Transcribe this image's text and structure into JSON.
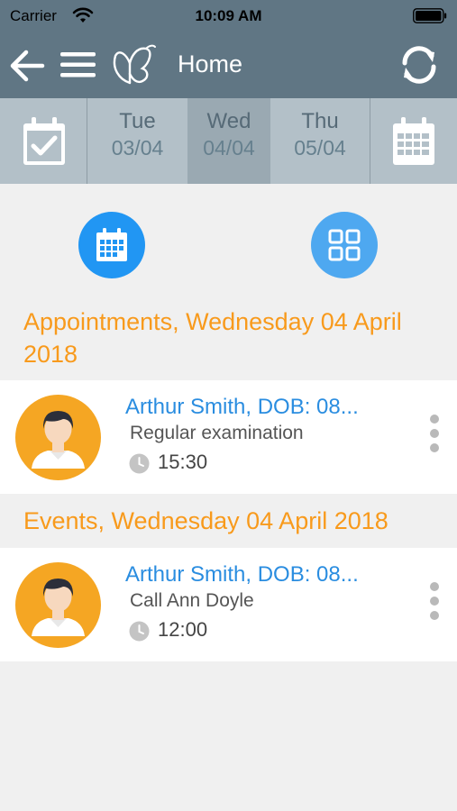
{
  "status_bar": {
    "carrier": "Carrier",
    "time": "10:09 AM"
  },
  "nav": {
    "title": "Home",
    "icons": [
      "arrow-left-icon",
      "hamburger-menu-icon",
      "butterfly-logo-icon",
      "refresh-icon"
    ]
  },
  "date_strip": {
    "days": [
      {
        "name": "Tue",
        "date": "03/04",
        "selected": false
      },
      {
        "name": "Wed",
        "date": "04/04",
        "selected": true
      },
      {
        "name": "Thu",
        "date": "05/04",
        "selected": false
      }
    ],
    "left_icon": "calendar-check-icon",
    "right_icon": "calendar-month-icon"
  },
  "actions": {
    "calendar_icon": "calendar-grid-icon",
    "grid_icon": "grid-view-icon"
  },
  "appointments": {
    "header": "Appointments, Wednesday 04 April 2018",
    "items": [
      {
        "name": "Arthur Smith, DOB: 08...",
        "description": "Regular examination",
        "time": "15:30"
      }
    ]
  },
  "events": {
    "header": "Events, Wednesday 04 April 2018",
    "items": [
      {
        "name": "Arthur Smith, DOB: 08...",
        "description": "Call Ann Doyle",
        "time": "12:00"
      }
    ]
  },
  "colors": {
    "nav_bg": "#607684",
    "accent_orange": "#f89a1c",
    "link_blue": "#2a8de0",
    "date_strip_bg": "#b3c0c8",
    "selected_day_bg": "#9aa9b2"
  }
}
